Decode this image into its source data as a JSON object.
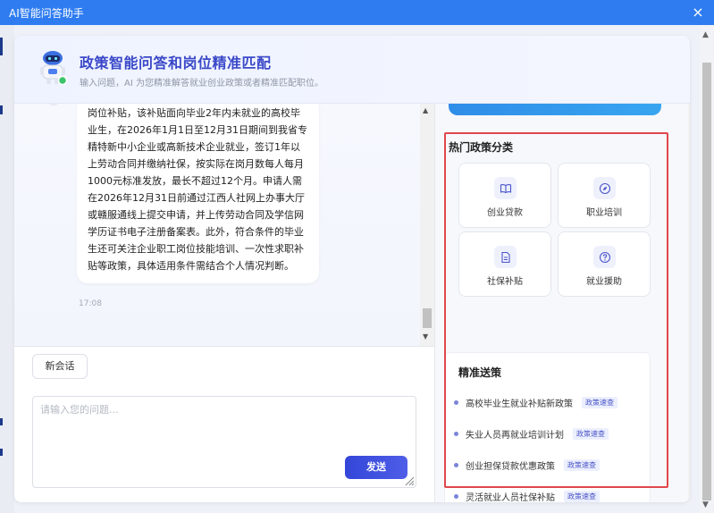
{
  "window": {
    "title": "AI智能问答助手",
    "close_label": "×"
  },
  "header": {
    "title": "政策智能问答和岗位精准匹配",
    "subtitle": "输入问题，AI 为您精准解答就业创业政策或者精准匹配职位。"
  },
  "chat": {
    "messages": [
      {
        "text": "岗位补贴，该补贴面向毕业2年内未就业的高校毕业生，在2026年1月1日至12月31日期间到我省专精特新中小企业或高新技术企业就业，签订1年以上劳动合同并缴纳社保，按实际在岗月数每人每月1000元标准发放，最长不超过12个月。申请人需在2026年12月31日前通过江西人社网上办事大厅或赣服通线上提交申请，并上传劳动合同及学信网学历证书电子注册备案表。此外，符合条件的毕业生还可关注企业职工岗位技能培训、一次性求职补贴等政策，具体适用条件需结合个人情况判断。",
        "time": "17:08"
      }
    ]
  },
  "composer": {
    "new_chat_label": "新会话",
    "placeholder": "请输入您的问题...",
    "value": "",
    "send_label": "发送"
  },
  "hot_categories": {
    "title": "热门政策分类",
    "items": [
      {
        "label": "创业贷款",
        "icon": "book-icon"
      },
      {
        "label": "职业培训",
        "icon": "compass-icon"
      },
      {
        "label": "社保补贴",
        "icon": "document-icon"
      },
      {
        "label": "就业援助",
        "icon": "help-icon"
      }
    ]
  },
  "recommend": {
    "title": "精准送策",
    "items": [
      {
        "text": "高校毕业生就业补贴新政策",
        "tag": "政策速查"
      },
      {
        "text": "失业人员再就业培训计划",
        "tag": "政策速查"
      },
      {
        "text": "创业担保贷款优惠政策",
        "tag": "政策速查"
      },
      {
        "text": "灵活就业人员社保补贴",
        "tag": "政策速查"
      }
    ]
  },
  "colors": {
    "titlebar": "#2e7cf0",
    "accent": "#3a48c8",
    "send_button": "#3346d8",
    "highlight_border": "#e0474d"
  }
}
